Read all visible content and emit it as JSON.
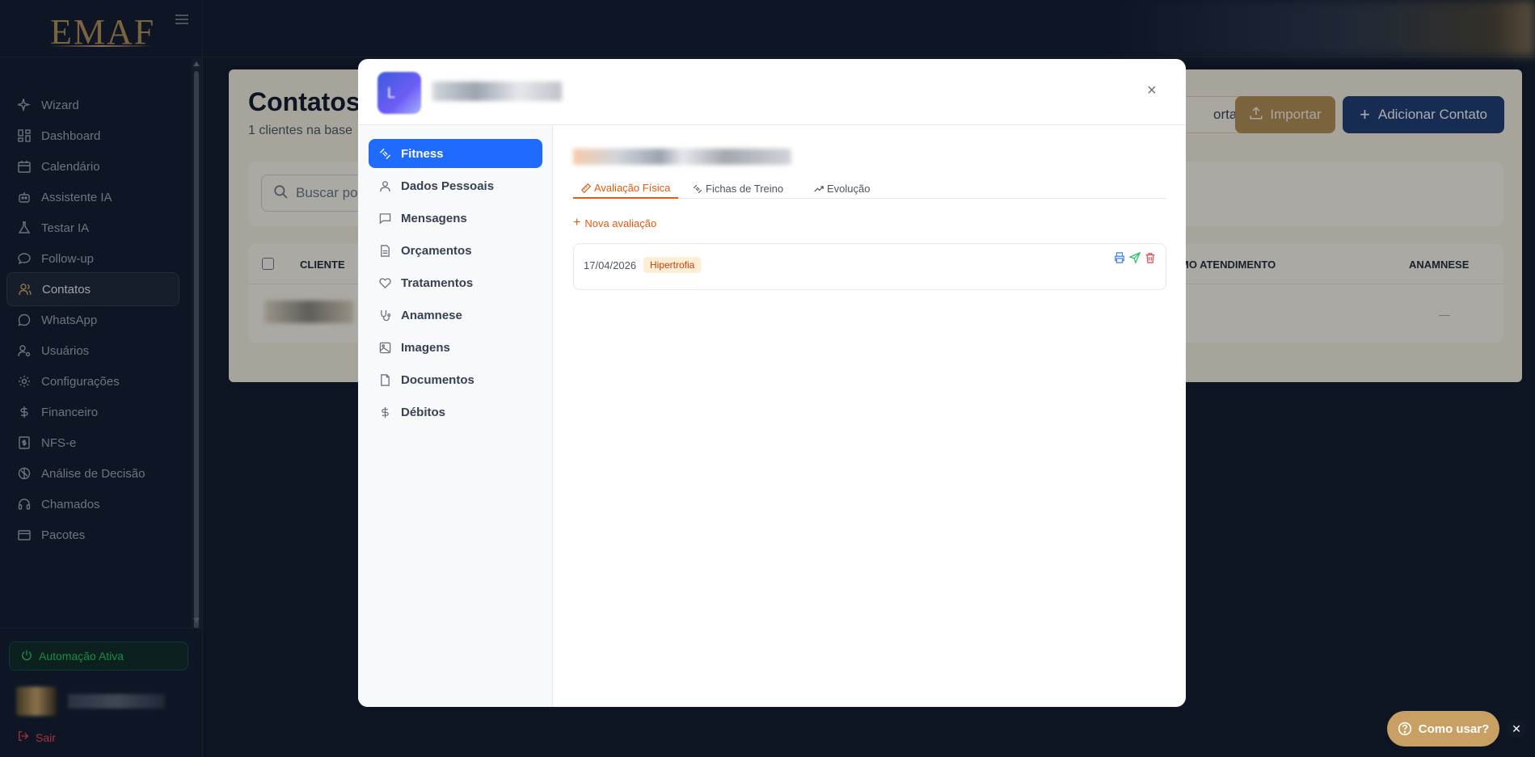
{
  "brand": {
    "logo_text": "EMAF"
  },
  "sidebar": {
    "items": [
      {
        "label": "Wizard",
        "icon": "sparkles-icon"
      },
      {
        "label": "Dashboard",
        "icon": "grid-icon"
      },
      {
        "label": "Calendário",
        "icon": "calendar-icon"
      },
      {
        "label": "Assistente IA",
        "icon": "bot-icon"
      },
      {
        "label": "Testar IA",
        "icon": "flask-icon"
      },
      {
        "label": "Follow-up",
        "icon": "chat-icon"
      },
      {
        "label": "Contatos",
        "icon": "users-icon",
        "active": true
      },
      {
        "label": "WhatsApp",
        "icon": "whatsapp-icon"
      },
      {
        "label": "Usuários",
        "icon": "user-gear-icon"
      },
      {
        "label": "Configurações",
        "icon": "gear-icon"
      },
      {
        "label": "Financeiro",
        "icon": "dollar-icon"
      },
      {
        "label": "NFS-e",
        "icon": "receipt-icon"
      },
      {
        "label": "Análise de Decisão",
        "icon": "brain-icon"
      },
      {
        "label": "Chamados",
        "icon": "headset-icon"
      },
      {
        "label": "Pacotes",
        "icon": "package-icon"
      }
    ],
    "automation_label": "Automação Ativa",
    "logout_label": "Sair"
  },
  "page": {
    "title": "Contatos",
    "subtitle": "1 clientes na base",
    "export_label": "ortar",
    "import_label": "Importar",
    "add_label": "Adicionar Contato",
    "search_placeholder": "Buscar po",
    "table_headers": {
      "client": "CLIENTE",
      "last": "MO ATENDIMENTO",
      "anamnese": "ANAMNESE"
    },
    "row_anamnese": "—"
  },
  "modal": {
    "avatar_letter": "L",
    "side_items": [
      {
        "label": "Fitness",
        "icon": "dumbbell-icon",
        "active": true
      },
      {
        "label": "Dados Pessoais",
        "icon": "user-icon"
      },
      {
        "label": "Mensagens",
        "icon": "message-icon"
      },
      {
        "label": "Orçamentos",
        "icon": "file-text-icon"
      },
      {
        "label": "Tratamentos",
        "icon": "heart-icon"
      },
      {
        "label": "Anamnese",
        "icon": "stethoscope-icon"
      },
      {
        "label": "Imagens",
        "icon": "image-icon"
      },
      {
        "label": "Documentos",
        "icon": "document-icon"
      },
      {
        "label": "Débitos",
        "icon": "dollar-icon"
      }
    ],
    "tabs": [
      {
        "label": "Avaliação Física",
        "icon": "ruler-icon",
        "active": true
      },
      {
        "label": "Fichas de Treino",
        "icon": "dumbbell-icon"
      },
      {
        "label": "Evolução",
        "icon": "trending-up-icon"
      }
    ],
    "new_eval_label": "Nova avaliação",
    "evaluation": {
      "date": "17/04/2026",
      "badge": "Hipertrofia"
    }
  },
  "help": {
    "label": "Como usar?"
  },
  "colors": {
    "accent_gold": "#c9a063",
    "modal_active": "#1f6bff",
    "tab_active": "#ea580c"
  }
}
